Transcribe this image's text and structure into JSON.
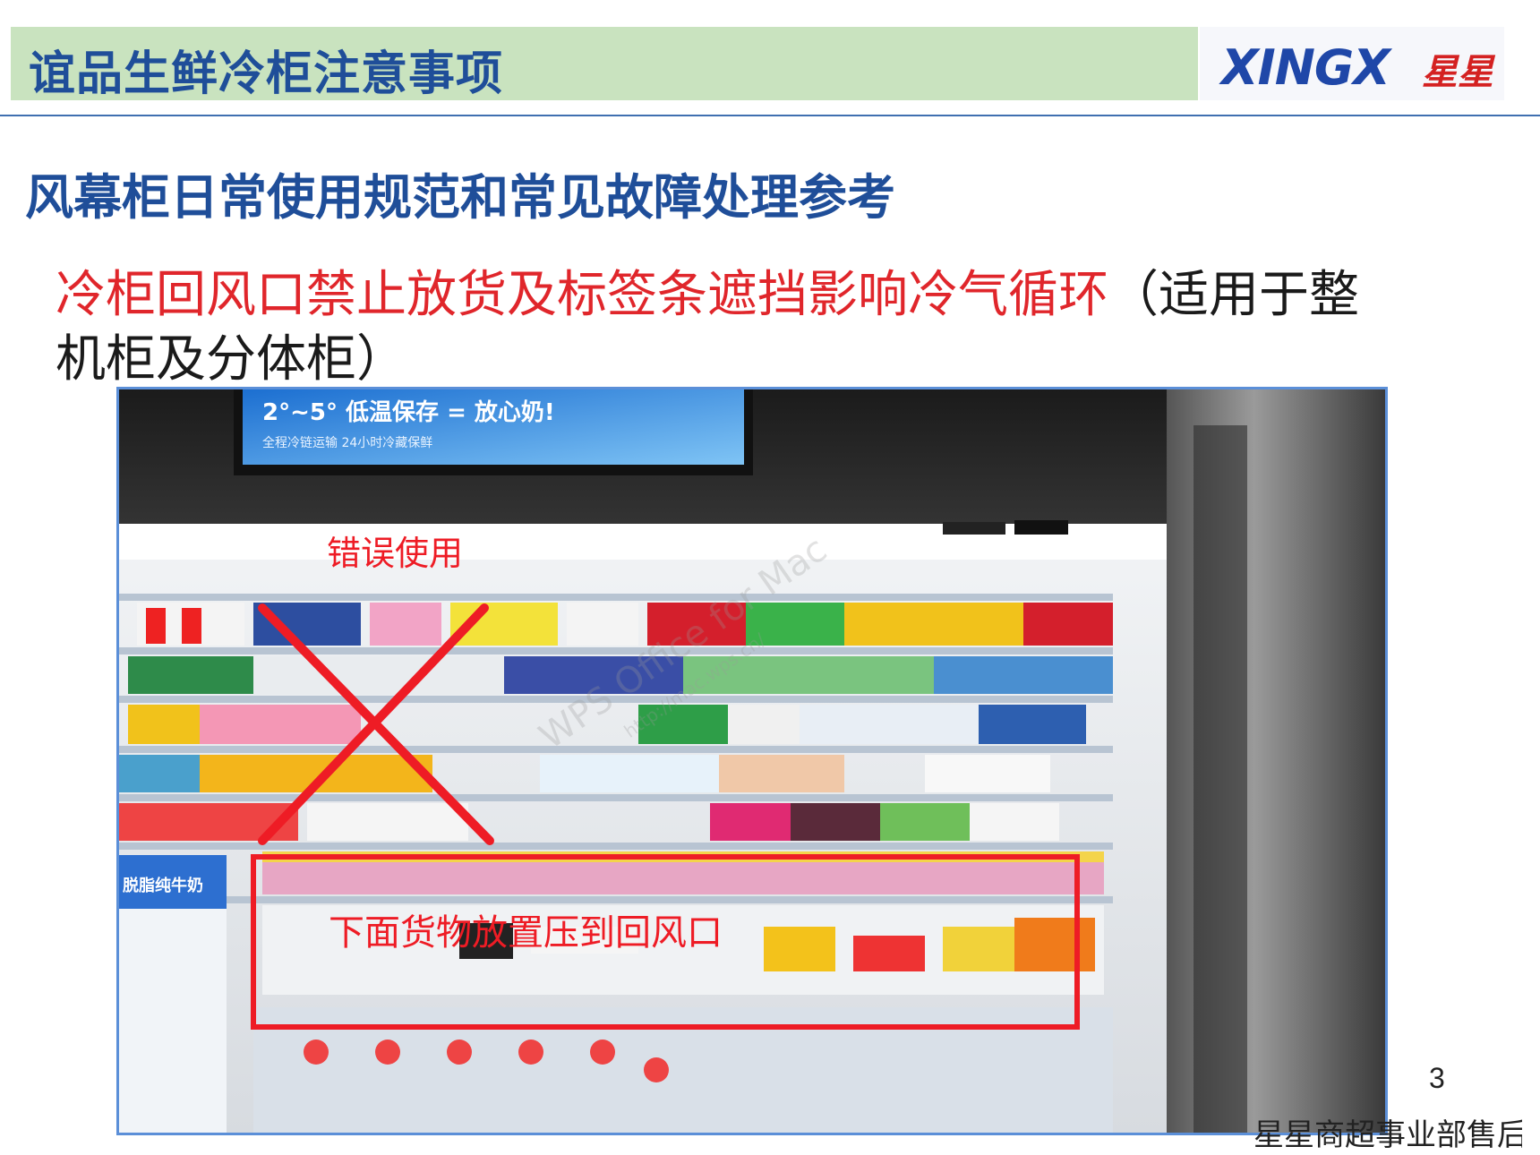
{
  "header": {
    "title": "谊品生鲜冷柜注意事项",
    "logo_text": "XINGX",
    "logo_script": "星星"
  },
  "subtitle": "风幕柜日常使用规范和常见故障处理参考",
  "body": {
    "red_part": "冷柜回风口禁止放货及标签条遮挡影响冷气循环",
    "black_part": "（适用于整机柜及分体柜）"
  },
  "photo": {
    "sign_line1": "2°~5° 低温保存 = 放心奶!",
    "sign_line2": "全程冷链运输 24小时冷藏保鲜",
    "watermark": "WPS Office for Mac",
    "watermark_url": "http://mac.wps.cn/",
    "label_wrong": "错误使用",
    "label_bottom": "下面货物放置压到回风口",
    "carton_label": "脱脂纯牛奶"
  },
  "page_number": "3",
  "footer": "星星商超事业部售后",
  "colors": {
    "title_blue": "#1f4e99",
    "alert_red": "#e0262b",
    "title_bar_green": "#c9e3bf"
  }
}
